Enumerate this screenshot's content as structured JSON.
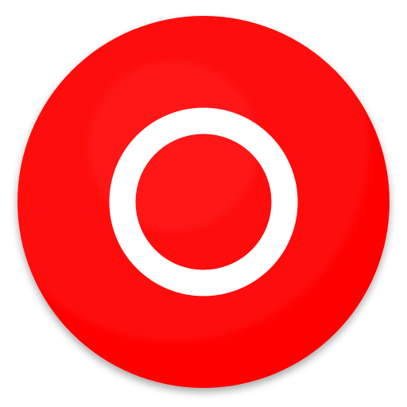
{
  "icon": {
    "name": "ring-icon",
    "disc_color": "#fe0000",
    "ring_color": "#ffffff",
    "background_color": "#ffffff"
  }
}
